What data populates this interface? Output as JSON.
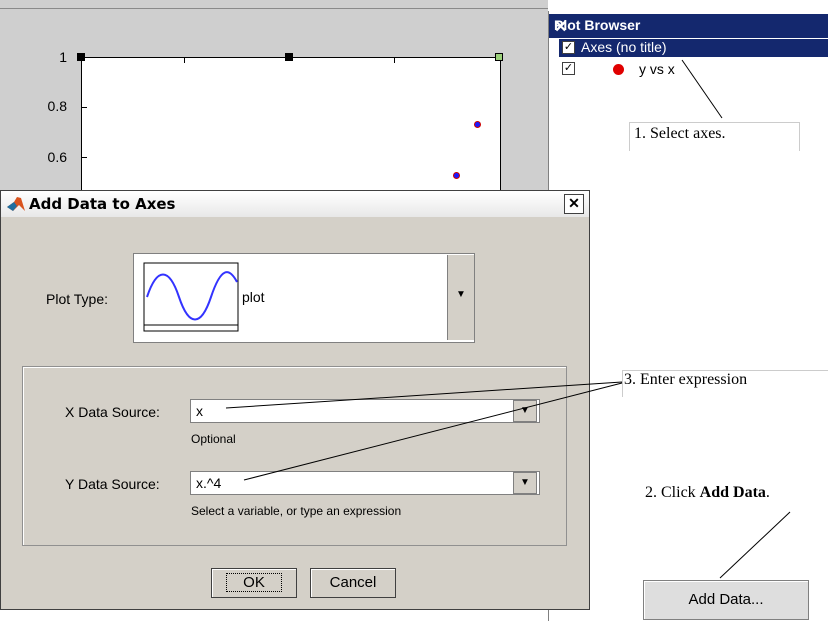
{
  "figure": {
    "y_ticks": [
      "1",
      "0.8",
      "0.6"
    ]
  },
  "plot_browser": {
    "title": "Plot Browser",
    "close_glyph": "✕",
    "items": [
      {
        "label": "Axes (no title)",
        "checked": true
      },
      {
        "label": "y vs x",
        "checked": true
      }
    ],
    "add_data_label": "Add Data..."
  },
  "dialog": {
    "title": "Add Data to Axes",
    "close_glyph": "✕",
    "plot_type_label": "Plot Type:",
    "plot_type_value": "plot",
    "x_source_label": "X Data Source:",
    "x_source_value": "x",
    "x_hint": "Optional",
    "y_source_label": "Y Data Source:",
    "y_source_value": "x.^4",
    "y_hint": "Select a variable, or type an expression",
    "ok_label": "OK",
    "cancel_label": "Cancel"
  },
  "annotations": {
    "step1": "1. Select axes.",
    "step2_prefix": "2. Click ",
    "step2_bold": "Add Data",
    "step2_suffix": ".",
    "step3": "3. Enter expression"
  },
  "colors": {
    "selection": "#14286e",
    "dialog_bg": "#d4d0c8",
    "marker_fill": "#1a1aff",
    "marker_edge": "#cc0000"
  },
  "icons": [
    "matlab-logo-icon",
    "checkbox-checked-icon",
    "close-icon",
    "chevron-down-icon",
    "sine-wave-icon"
  ]
}
